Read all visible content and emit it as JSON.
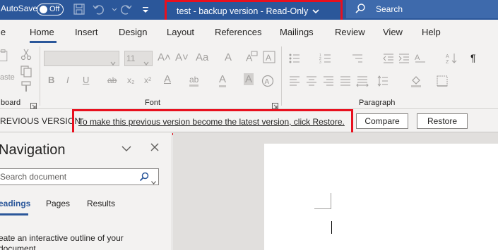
{
  "titlebar": {
    "autosave_label": "AutoSave",
    "autosave_state": "Off",
    "document_title": "test  -  backup version  -  Read-Only",
    "search_placeholder": "Search",
    "bg_color": "#2b579a"
  },
  "tabs": [
    {
      "label": "le"
    },
    {
      "label": "Home"
    },
    {
      "label": "Insert"
    },
    {
      "label": "Design"
    },
    {
      "label": "Layout"
    },
    {
      "label": "References"
    },
    {
      "label": "Mailings"
    },
    {
      "label": "Review"
    },
    {
      "label": "View"
    },
    {
      "label": "Help"
    }
  ],
  "ribbon": {
    "paste_label": "aste",
    "clipboard_label": "board",
    "font_label": "Font",
    "paragraph_label": "Paragraph",
    "font_size": "11",
    "font_glyphs": {
      "bold": "B",
      "italic": "I",
      "underline": "U",
      "strike": "ab",
      "sub": "x₂",
      "sup": "x²",
      "grow": "A˄",
      "shrink": "A˅",
      "case": "Aa",
      "clear": "A",
      "effects": "A",
      "highlight": "ab",
      "color": "A"
    },
    "paragraph_mark": "¶"
  },
  "previous_version_bar": {
    "title": "REVIOUS VERSION",
    "message": "To make this previous version become the latest version, click Restore.",
    "compare_label": "Compare",
    "restore_label": "Restore"
  },
  "navigation": {
    "title": "Navigation",
    "search_placeholder": "Search document",
    "tabs": [
      {
        "label": "eadings"
      },
      {
        "label": "Pages"
      },
      {
        "label": "Results"
      }
    ],
    "description": "eate an interactive outline of your document."
  },
  "colors": {
    "accent": "#2b579a",
    "highlight_box": "#e8101e"
  }
}
